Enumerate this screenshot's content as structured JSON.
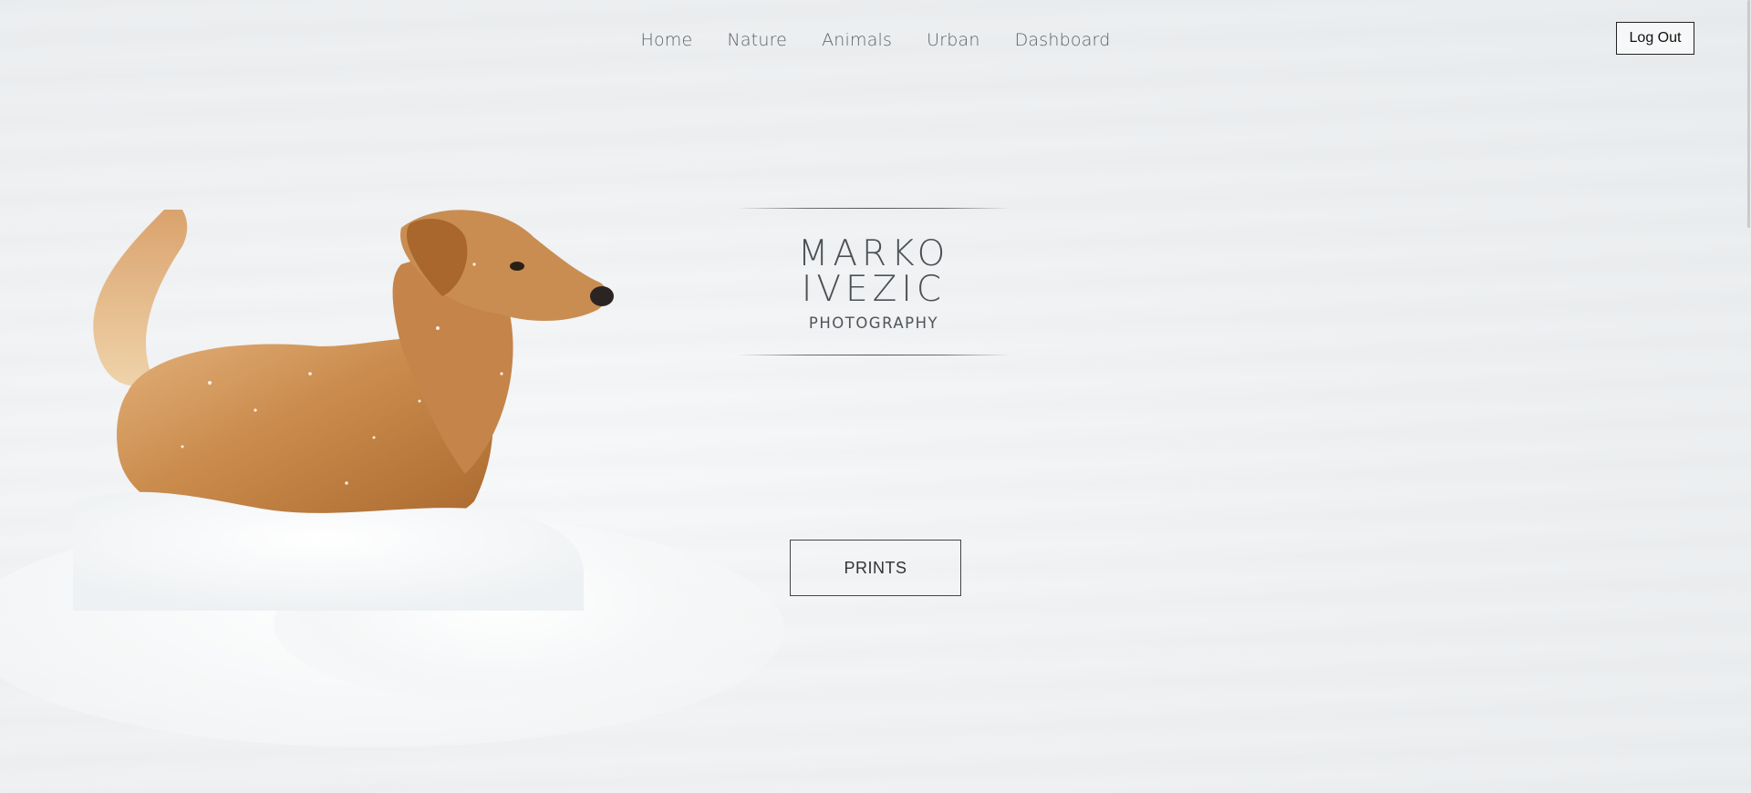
{
  "nav": {
    "items": [
      {
        "label": "Home"
      },
      {
        "label": "Nature"
      },
      {
        "label": "Animals"
      },
      {
        "label": "Urban"
      },
      {
        "label": "Dashboard"
      }
    ]
  },
  "header": {
    "logout_label": "Log Out"
  },
  "hero": {
    "title": "MARKO IVEZIC",
    "subtitle": "PHOTOGRAPHY",
    "cta_label": "PRINTS",
    "image_subject": "golden retriever in snow"
  },
  "colors": {
    "background": "#eef0f2",
    "text": "#4b5055",
    "border": "#222222"
  }
}
